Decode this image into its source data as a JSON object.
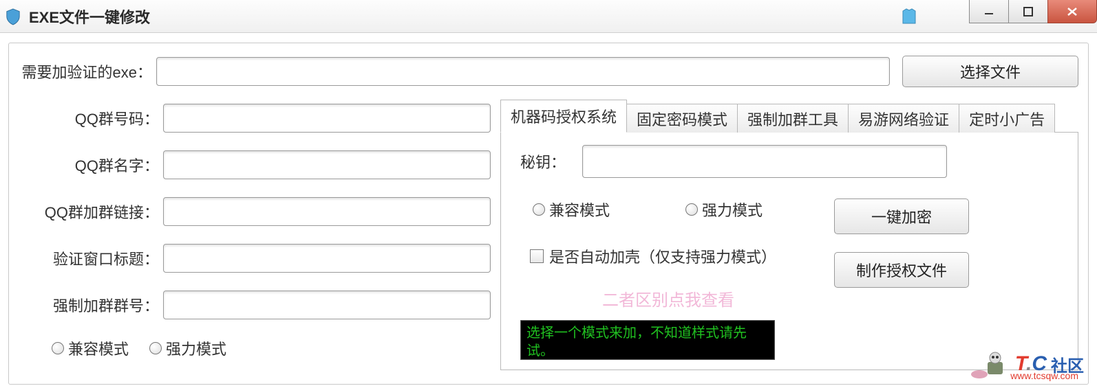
{
  "window": {
    "title": "EXE文件一键修改"
  },
  "toolbar": {
    "choose_file": "选择文件"
  },
  "labels": {
    "exe_to_verify": "需要加验证的exe：",
    "qq_group_number": "QQ群号码：",
    "qq_group_name": "QQ群名字：",
    "qq_group_link": "QQ群加群链接：",
    "verify_window_title": "验证窗口标题：",
    "force_group_number": "强制加群群号：",
    "secret_key": "秘钥："
  },
  "modes": {
    "compat": "兼容模式",
    "strong": "强力模式"
  },
  "checkbox": {
    "auto_shell": "是否自动加壳（仅支持强力模式）"
  },
  "link": {
    "diff": "二者区别点我查看"
  },
  "buttons": {
    "encrypt": "一键加密",
    "make_auth": "制作授权文件"
  },
  "tabs": [
    "机器码授权系统",
    "固定密码模式",
    "强制加群工具",
    "易游网络验证",
    "定时小广告"
  ],
  "console": {
    "line": "选择一个模式来加，不知道样式请先试。"
  },
  "watermark": {
    "t": "T",
    "c": "C",
    "cn": "社区",
    "url": "www.tcsqw.com"
  }
}
